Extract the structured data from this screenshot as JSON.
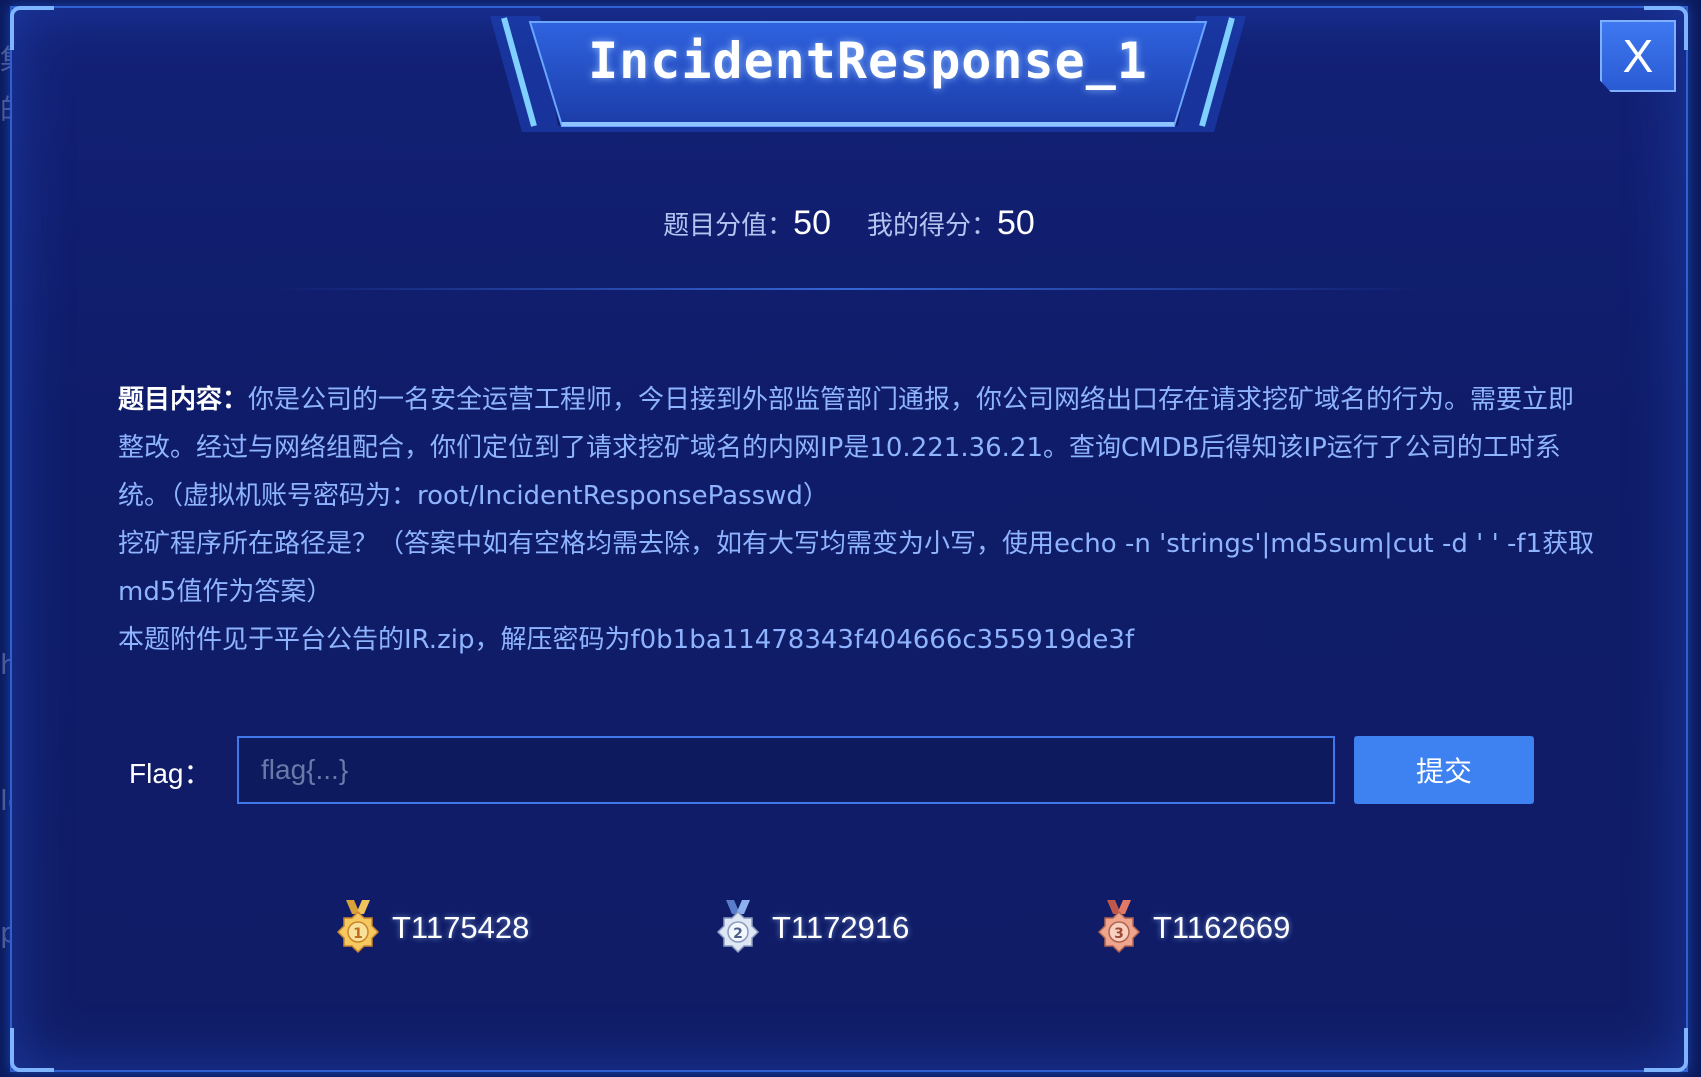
{
  "background": {
    "edge_fragments": [
      "集",
      "的",
      "ha",
      "le",
      "p"
    ]
  },
  "modal": {
    "title": "IncidentResponse_1",
    "close_label": "X",
    "score": {
      "value_label": "题目分值：",
      "value": "50",
      "my_label": "我的得分：",
      "my_value": "50"
    },
    "content": {
      "label": "题目内容：",
      "lines": [
        "你是公司的一名安全运营工程师，今日接到外部监管部门通报，你公司网络出口存在请求挖矿域名的行为。需要立即整改。经过与网络组配合，你们定位到了请求挖矿域名的内网IP是10.221.36.21。查询CMDB后得知该IP运行了公司的工时系统。（虚拟机账号密码为：root/IncidentResponsePasswd）",
        "挖矿程序所在路径是？（答案中如有空格均需去除，如有大写均需变为小写，使用echo -n 'strings'|md5sum|cut -d ' ' -f1获取md5值作为答案）",
        "本题附件见于平台公告的IR.zip，解压密码为f0b1ba11478343f404666c355919de3f"
      ]
    },
    "flag": {
      "label": "Flag：",
      "placeholder": "flag{...}",
      "value": "",
      "submit_label": "提交"
    },
    "winners": [
      {
        "rank": "1",
        "name": "T1175428",
        "medal_color": "#e8b04a"
      },
      {
        "rank": "2",
        "name": "T1172916",
        "medal_color": "#c9d6ea"
      },
      {
        "rank": "3",
        "name": "T1162669",
        "medal_color": "#e0876a"
      }
    ]
  }
}
